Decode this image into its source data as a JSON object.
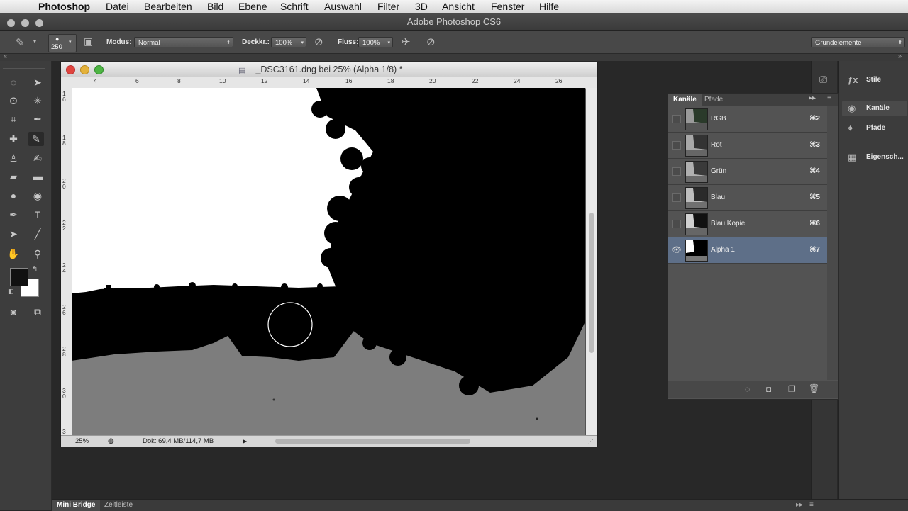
{
  "menubar": {
    "app_name": "Photoshop",
    "items": [
      "Datei",
      "Bearbeiten",
      "Bild",
      "Ebene",
      "Schrift",
      "Auswahl",
      "Filter",
      "3D",
      "Ansicht",
      "Fenster",
      "Hilfe"
    ]
  },
  "window": {
    "title": "Adobe Photoshop CS6"
  },
  "options_bar": {
    "brush_size": "250",
    "mode_label": "Modus:",
    "mode_value": "Normal",
    "opacity_label": "Deckkr.:",
    "opacity_value": "100%",
    "flow_label": "Fluss:",
    "flow_value": "100%",
    "workspace_value": "Grundelemente"
  },
  "document": {
    "title": "_DSC3161.dng bei 25% (Alpha 1/8) *",
    "zoom": "25%",
    "doc_size": "Dok: 69,4 MB/114,7 MB",
    "ruler_h": [
      "4",
      "6",
      "8",
      "10",
      "12",
      "14",
      "16",
      "18",
      "20",
      "22",
      "24",
      "26"
    ],
    "ruler_v": [
      [
        "1",
        "6"
      ],
      [
        "1",
        "8"
      ],
      [
        "2",
        "0"
      ],
      [
        "2",
        "2"
      ],
      [
        "2",
        "4"
      ],
      [
        "2",
        "6"
      ],
      [
        "2",
        "8"
      ],
      [
        "3",
        "0"
      ],
      [
        "3"
      ]
    ]
  },
  "dock_panels": [
    {
      "label": "Stile",
      "icon": "styles-icon"
    },
    {
      "label": "Kanäle",
      "icon": "channels-icon"
    },
    {
      "label": "Pfade",
      "icon": "paths-icon"
    },
    {
      "label": "Eigensch...",
      "icon": "properties-icon"
    }
  ],
  "channels_panel": {
    "tabs": [
      "Kanäle",
      "Pfade"
    ],
    "channels": [
      {
        "name": "RGB",
        "shortcut": "⌘2",
        "visible": false
      },
      {
        "name": "Rot",
        "shortcut": "⌘3",
        "visible": false
      },
      {
        "name": "Grün",
        "shortcut": "⌘4",
        "visible": false
      },
      {
        "name": "Blau",
        "shortcut": "⌘5",
        "visible": false
      },
      {
        "name": "Blau Kopie",
        "shortcut": "⌘6",
        "visible": false
      },
      {
        "name": "Alpha 1",
        "shortcut": "⌘7",
        "visible": true
      }
    ]
  },
  "bottom_tabs": [
    "Mini Bridge",
    "Zeitleiste"
  ],
  "colors": {
    "selected_row": "#5e6f88",
    "foreground": "#111111",
    "background": "#ffffff"
  }
}
